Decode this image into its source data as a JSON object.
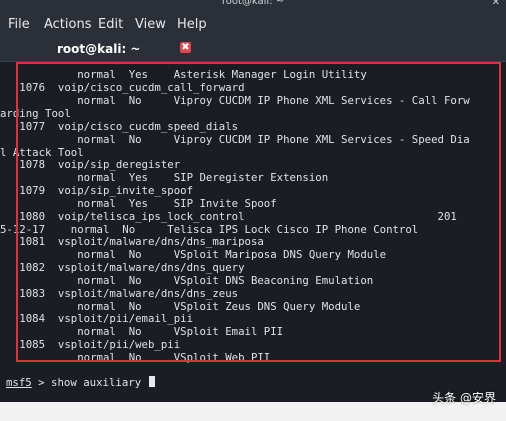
{
  "window": {
    "title": "root@kali: ~",
    "close_glyph": "✕"
  },
  "menu": {
    "items": [
      "File",
      "Actions",
      "Edit",
      "View",
      "Help"
    ]
  },
  "tab": {
    "label": "root@kali: ~",
    "close_glyph": "✖"
  },
  "terminal": {
    "lines": [
      "            normal  Yes    Asterisk Manager Login Utility",
      "   1076  voip/cisco_cucdm_call_forward",
      "            normal  No     Viproy CUCDM IP Phone XML Services - Call Forw",
      "arding Tool",
      "   1077  voip/cisco_cucdm_speed_dials",
      "            normal  No     Viproy CUCDM IP Phone XML Services - Speed Dia",
      "l Attack Tool",
      "   1078  voip/sip_deregister",
      "            normal  Yes    SIP Deregister Extension",
      "   1079  voip/sip_invite_spoof",
      "            normal  Yes    SIP Invite Spoof",
      "   1080  voip/telisca_ips_lock_control                              201",
      "5-12-17    normal  No     Telisca IPS Lock Cisco IP Phone Control",
      "   1081  vsploit/malware/dns/dns_mariposa",
      "            normal  No     VSploit Mariposa DNS Query Module",
      "   1082  vsploit/malware/dns/dns_query",
      "            normal  No     VSploit DNS Beaconing Emulation",
      "   1083  vsploit/malware/dns/dns_zeus",
      "            normal  No     VSploit Zeus DNS Query Module",
      "   1084  vsploit/pii/email_pii",
      "            normal  No     VSploit Email PII",
      "   1085  vsploit/pii/web_pii",
      "            normal  No     VSploit Web PII"
    ],
    "prompt_name": "msf5",
    "prompt_rest": " > show auxiliary "
  },
  "watermark": "头条 @安界",
  "colors": {
    "highlight_box": "#e0313a",
    "tab_close": "#e0464e",
    "terminal_bg": "#1a1e24"
  }
}
